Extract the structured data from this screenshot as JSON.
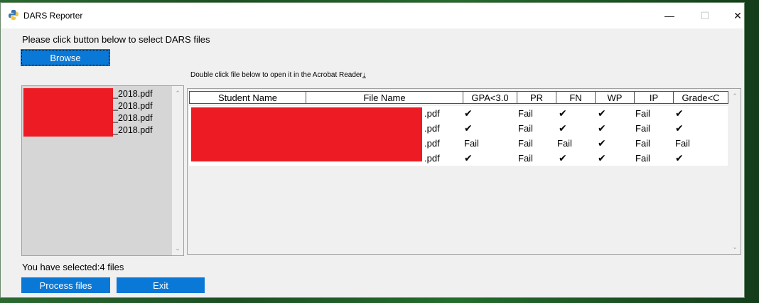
{
  "window": {
    "title": "DARS Reporter",
    "controls": {
      "minimize": "—",
      "maximize": "☐",
      "close": "✕"
    }
  },
  "main": {
    "prompt": "Please click button below to select DARS files",
    "browse_label": "Browse",
    "hint": "Double click file below to open it in the Acrobat Reader",
    "hint_arrow": "↓",
    "status": "You have selected:4 files",
    "process_label": "Process files",
    "exit_label": "Exit"
  },
  "file_list": {
    "items": [
      {
        "suffix": "_2018.pdf"
      },
      {
        "suffix": "_2018.pdf"
      },
      {
        "suffix": "_2018.pdf"
      },
      {
        "suffix": "_2018.pdf"
      }
    ]
  },
  "table": {
    "columns": [
      "Student Name",
      "File Name",
      "GPA<3.0",
      "PR",
      "FN",
      "WP",
      "IP",
      "Grade<C"
    ],
    "rows": [
      {
        "file_suffix": ".pdf",
        "gpa": "✔",
        "pr": "Fail",
        "fn": "✔",
        "wp": "✔",
        "ip": "Fail",
        "grade": "✔"
      },
      {
        "file_suffix": ".pdf",
        "gpa": "✔",
        "pr": "Fail",
        "fn": "✔",
        "wp": "✔",
        "ip": "Fail",
        "grade": "✔"
      },
      {
        "file_suffix": ".pdf",
        "gpa": "Fail",
        "pr": "Fail",
        "fn": "Fail",
        "wp": "✔",
        "ip": "Fail",
        "grade": "Fail"
      },
      {
        "file_suffix": ".pdf",
        "gpa": "✔",
        "pr": "Fail",
        "fn": "✔",
        "wp": "✔",
        "ip": "Fail",
        "grade": "✔"
      }
    ]
  },
  "scrollbar": {
    "up": "⌃",
    "down": "⌄"
  },
  "colors": {
    "accent": "#0a78d7",
    "redaction": "#ed1c24"
  }
}
